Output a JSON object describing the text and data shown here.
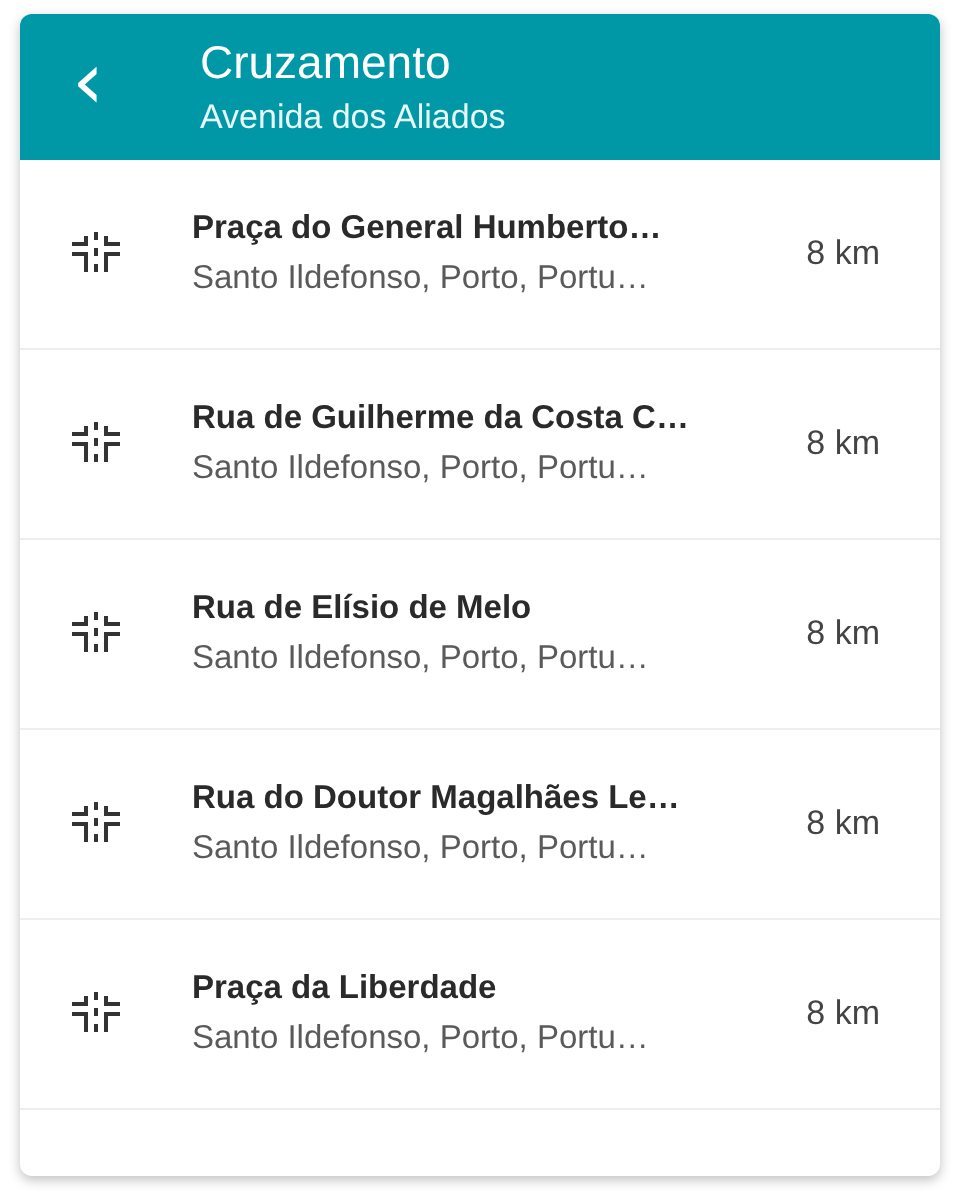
{
  "header": {
    "back": "‹",
    "title": "Cruzamento",
    "subtitle": "Avenida dos Aliados"
  },
  "results": [
    {
      "name": "Praça do General Humberto…",
      "address": "Santo Ildefonso, Porto, Portu…",
      "distance": "8 km"
    },
    {
      "name": "Rua de Guilherme da Costa C…",
      "address": "Santo Ildefonso, Porto, Portu…",
      "distance": "8 km"
    },
    {
      "name": "Rua de Elísio de Melo",
      "address": "Santo Ildefonso, Porto, Portu…",
      "distance": "8 km"
    },
    {
      "name": "Rua do Doutor Magalhães Le…",
      "address": "Santo Ildefonso, Porto, Portu…",
      "distance": "8 km"
    },
    {
      "name": "Praça da Liberdade",
      "address": "Santo Ildefonso, Porto, Portu…",
      "distance": "8 km"
    }
  ]
}
